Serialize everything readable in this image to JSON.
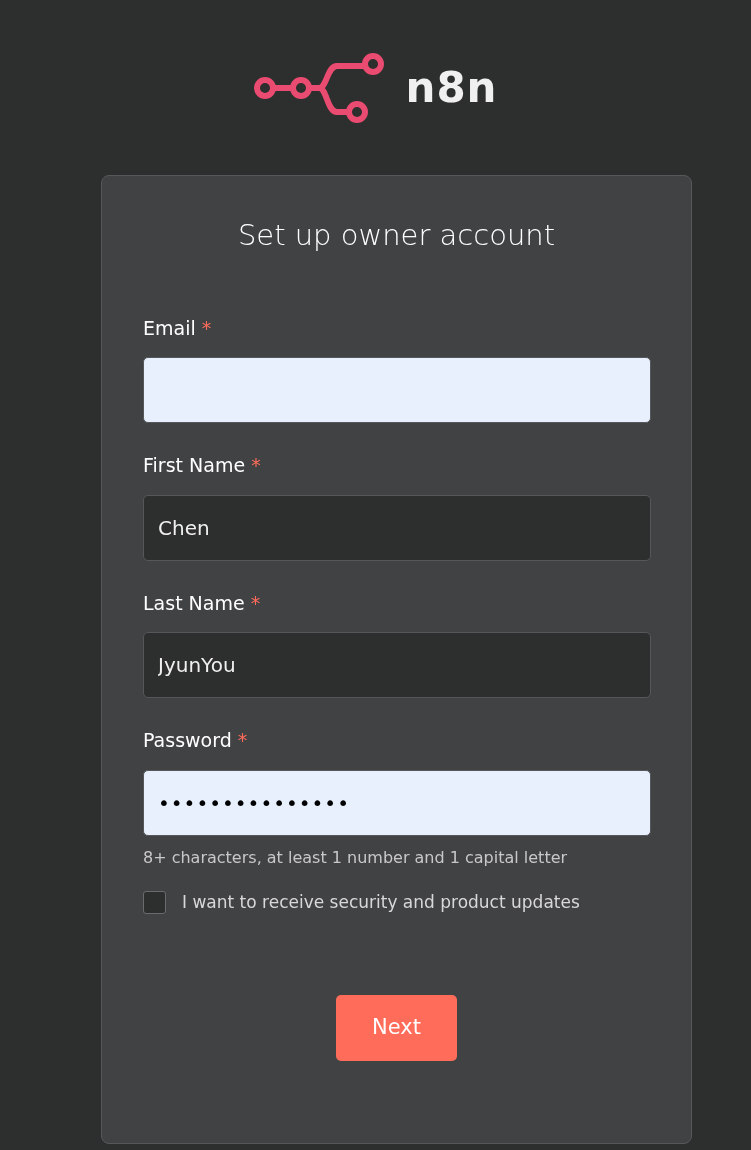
{
  "logo": {
    "text": "n8n"
  },
  "form": {
    "title": "Set up owner account",
    "fields": [
      {
        "label": "Email",
        "required": "*",
        "autofilled": true
      },
      {
        "label": "First Name",
        "required": "*",
        "value": "Chen",
        "autofilled": false
      },
      {
        "label": "Last Name",
        "required": "*",
        "value": "JyunYou",
        "autofilled": false
      },
      {
        "label": "Password",
        "required": "*",
        "value": "•••••••••••••••",
        "autofilled": true,
        "hint": "8+ characters, at least 1 number and 1 capital letter"
      }
    ],
    "checkbox": {
      "label": "I want to receive security and product updates",
      "checked": false
    },
    "button": "Next"
  }
}
